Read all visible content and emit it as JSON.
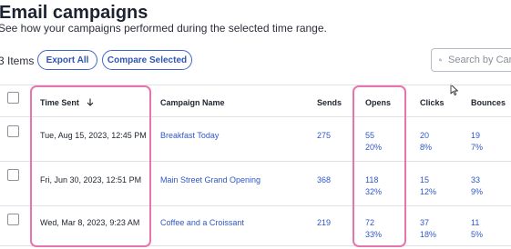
{
  "page": {
    "title": "Email campaigns",
    "subtitle": "See how your campaigns performed during the selected time range."
  },
  "toolbar": {
    "items_count": "3 Items",
    "export_label": "Export All",
    "compare_label": "Compare Selected",
    "search_placeholder": "Search by Campaign"
  },
  "table": {
    "columns": [
      "Time Sent",
      "Campaign Name",
      "Sends",
      "Opens",
      "Clicks",
      "Bounces"
    ],
    "sort_column": "Time Sent",
    "sort_direction": "descending",
    "rows": [
      {
        "time_sent": "Tue, Aug 15, 2023, 12:45 PM",
        "campaign_name": "Breakfast Today",
        "sends": "275",
        "opens": "55",
        "opens_pct": "20%",
        "clicks": "20",
        "clicks_pct": "8%",
        "bounces": "19",
        "bounces_pct": "7%"
      },
      {
        "time_sent": "Fri, Jun 30, 2023, 12:51 PM",
        "campaign_name": "Main Street Grand Opening",
        "sends": "368",
        "opens": "118",
        "opens_pct": "32%",
        "clicks": "15",
        "clicks_pct": "12%",
        "bounces": "33",
        "bounces_pct": "9%"
      },
      {
        "time_sent": "Wed, Mar 8, 2023, 9:23 AM",
        "campaign_name": "Coffee and a Croissant",
        "sends": "219",
        "opens": "72",
        "opens_pct": "33%",
        "clicks": "37",
        "clicks_pct": "18%",
        "bounces": "11",
        "bounces_pct": "5%"
      }
    ]
  },
  "highlighted_columns": [
    "Time Sent",
    "Opens"
  ],
  "colors": {
    "link": "#2f57c7",
    "highlight": "#e874ad",
    "button_border": "#3f66c9"
  },
  "icons": {
    "sort": "arrow-down-icon",
    "search": "search-icon",
    "cursor": "mouse-pointer-icon"
  }
}
